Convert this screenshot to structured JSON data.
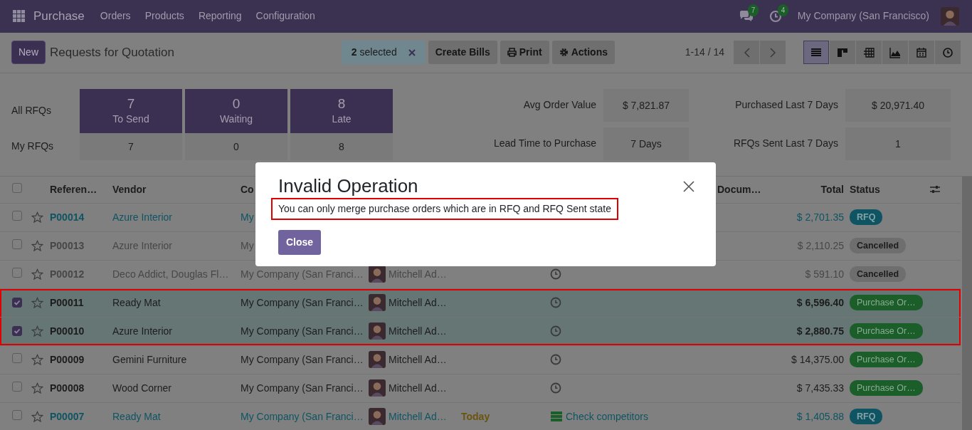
{
  "navbar": {
    "app": "Purchase",
    "menu": [
      "Orders",
      "Products",
      "Reporting",
      "Configuration"
    ],
    "messages_count": "7",
    "activities_count": "4",
    "company": "My Company (San Francisco)"
  },
  "control_panel": {
    "new_button": "New",
    "title": "Requests for Quotation",
    "selection": "**2** selected",
    "actions": [
      {
        "kind": "bills",
        "label": "Create Bills"
      },
      {
        "kind": "print",
        "label": "Print"
      },
      {
        "kind": "gear",
        "label": "Actions"
      }
    ],
    "pager": "1-14 / 14",
    "views": [
      {
        "kind": "list",
        "selected": true
      },
      {
        "kind": "kanban",
        "selected": false
      },
      {
        "kind": "pivot",
        "selected": false
      },
      {
        "kind": "graph",
        "selected": false
      },
      {
        "kind": "calendar",
        "selected": false
      },
      {
        "kind": "activity",
        "selected": false
      }
    ]
  },
  "dashboard": {
    "rows": [
      {
        "label": "All RFQs",
        "cells": [
          {
            "value": "7",
            "caption": "To Send"
          },
          {
            "value": "0",
            "caption": "Waiting"
          },
          {
            "value": "8",
            "caption": "Late"
          }
        ]
      },
      {
        "label": "My RFQs",
        "cells": [
          {
            "value": "7"
          },
          {
            "value": "0"
          },
          {
            "value": "8"
          }
        ]
      }
    ],
    "stats": [
      {
        "label": "Avg Order Value",
        "value": "$ 7,821.87"
      },
      {
        "label": "Purchased Last 7 Days",
        "value": "$ 20,971.40"
      },
      {
        "label": "Lead Time to Purchase",
        "value": "7 Days"
      },
      {
        "label": "RFQs Sent Last 7 Days",
        "value": "1"
      }
    ]
  },
  "table": {
    "all_selected": false,
    "columns": [
      {
        "kind": "reference",
        "label": "Referen…"
      },
      {
        "kind": "vendor",
        "label": "Vendor"
      },
      {
        "kind": "company",
        "label": "Co"
      },
      {
        "kind": "source",
        "label": "Docum…"
      },
      {
        "kind": "total",
        "label": "Total"
      },
      {
        "kind": "status",
        "label": "Status"
      }
    ],
    "rows": [
      {
        "selected": false,
        "starred": false,
        "boxed": false,
        "kind": "info",
        "reference": "P00014",
        "vendor": "Azure Interior",
        "company": "My",
        "total": "$ 2,701.35",
        "status": {
          "kind": "rfq",
          "label": "RFQ"
        }
      },
      {
        "selected": false,
        "starred": false,
        "boxed": false,
        "kind": "muted",
        "reference": "P00013",
        "vendor": "Azure Interior",
        "company": "My",
        "total": "$ 2,110.25",
        "status": {
          "kind": "cancelled",
          "label": "Cancelled"
        }
      },
      {
        "selected": false,
        "starred": false,
        "boxed": false,
        "kind": "muted",
        "reference": "P00012",
        "vendor": "Deco Addict, Douglas Fl…",
        "company": "My Company (San Franci…",
        "buyer": "Mitchell Ad…",
        "activity": {
          "kind": "none"
        },
        "total": "$ 591.10",
        "status": {
          "kind": "cancelled",
          "label": "Cancelled"
        }
      },
      {
        "selected": true,
        "starred": false,
        "boxed": true,
        "kind": "normal",
        "reference": "P00011",
        "vendor": "Ready Mat",
        "company": "My Company (San Franci…",
        "buyer": "Mitchell Ad…",
        "activity": {
          "kind": "none"
        },
        "total": "$ 6,596.40",
        "status": {
          "kind": "purchase",
          "label": "Purchase Or…"
        }
      },
      {
        "selected": true,
        "starred": false,
        "boxed": true,
        "kind": "normal",
        "reference": "P00010",
        "vendor": "Azure Interior",
        "company": "My Company (San Franci…",
        "buyer": "Mitchell Ad…",
        "activity": {
          "kind": "none"
        },
        "total": "$ 2,880.75",
        "status": {
          "kind": "purchase",
          "label": "Purchase Or…"
        }
      },
      {
        "selected": false,
        "starred": false,
        "boxed": false,
        "kind": "normal",
        "reference": "P00009",
        "vendor": "Gemini Furniture",
        "company": "My Company (San Franci…",
        "buyer": "Mitchell Ad…",
        "activity": {
          "kind": "none"
        },
        "total": "$ 14,375.00",
        "status": {
          "kind": "purchase",
          "label": "Purchase Or…"
        }
      },
      {
        "selected": false,
        "starred": false,
        "boxed": false,
        "kind": "normal",
        "reference": "P00008",
        "vendor": "Wood Corner",
        "company": "My Company (San Franci…",
        "buyer": "Mitchell Ad…",
        "activity": {
          "kind": "none"
        },
        "total": "$ 7,435.33",
        "status": {
          "kind": "purchase",
          "label": "Purchase Or…"
        }
      },
      {
        "selected": false,
        "starred": false,
        "boxed": false,
        "kind": "info",
        "reference": "P00007",
        "vendor": "Ready Mat",
        "company": "My Company (San Franci…",
        "buyer": "Mitchell Ad…",
        "deadline": "Today",
        "activity": {
          "kind": "todo",
          "label": "Check competitors"
        },
        "total": "$ 1,405.88",
        "status": {
          "kind": "rfq",
          "label": "RFQ"
        }
      }
    ]
  },
  "dialog": {
    "title": "Invalid Operation",
    "message": "You can only merge purchase orders which are in RFQ and RFQ Sent state",
    "message_boxed": true,
    "button": "Close"
  }
}
